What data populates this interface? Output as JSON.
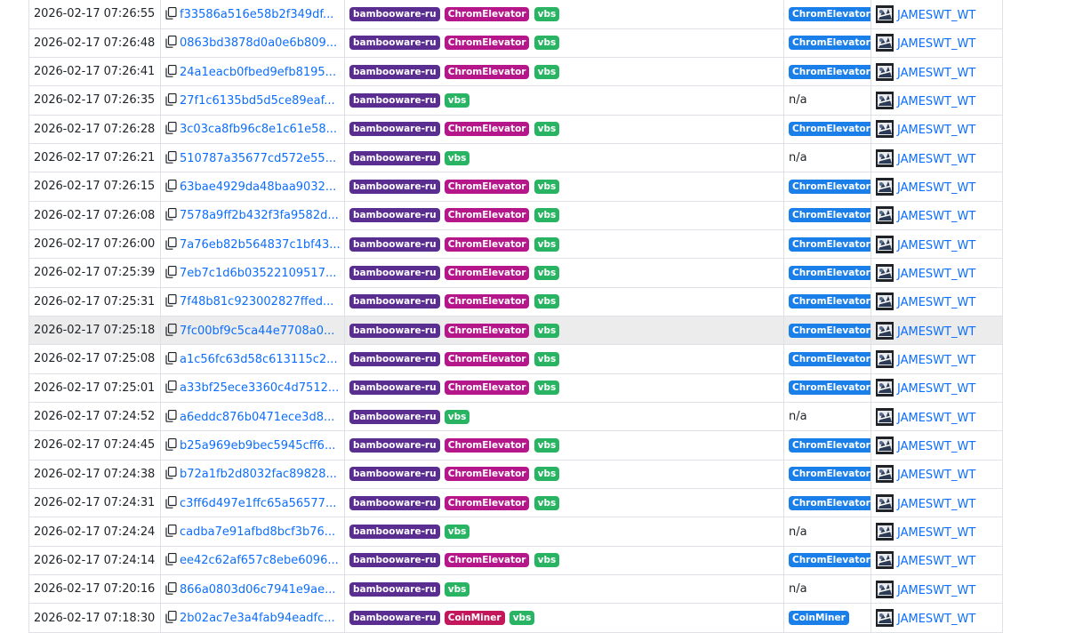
{
  "colors": {
    "link": "#0d6efd",
    "tag_bambooware": "#5a2d91",
    "tag_chromelevator": "#b5178b",
    "tag_coinminer": "#c2185b",
    "tag_vbs": "#28b463",
    "signature_badge": "#1a7fe8",
    "highlight_row": "#ececec"
  },
  "icons": {
    "copy": "copy-icon",
    "avatar": "reporter-avatar"
  },
  "rows": [
    {
      "date": "2026-02-17 07:26:55",
      "hash": "f33586a516e58b2f349df...",
      "tags": [
        "bambooware-ru",
        "ChromElevator",
        "vbs"
      ],
      "signature": "ChromElevator",
      "reporter": "JAMESWT_WT"
    },
    {
      "date": "2026-02-17 07:26:48",
      "hash": "0863bd3878d0a0e6b809...",
      "tags": [
        "bambooware-ru",
        "ChromElevator",
        "vbs"
      ],
      "signature": "ChromElevator",
      "reporter": "JAMESWT_WT"
    },
    {
      "date": "2026-02-17 07:26:41",
      "hash": "24a1eacb0fbed9efb8195...",
      "tags": [
        "bambooware-ru",
        "ChromElevator",
        "vbs"
      ],
      "signature": "ChromElevator",
      "reporter": "JAMESWT_WT"
    },
    {
      "date": "2026-02-17 07:26:35",
      "hash": "27f1c6135bd5d5ce89eaf...",
      "tags": [
        "bambooware-ru",
        "vbs"
      ],
      "signature": "n/a",
      "reporter": "JAMESWT_WT"
    },
    {
      "date": "2026-02-17 07:26:28",
      "hash": "3c03ca8fb96c8e1c61e58...",
      "tags": [
        "bambooware-ru",
        "ChromElevator",
        "vbs"
      ],
      "signature": "ChromElevator",
      "reporter": "JAMESWT_WT"
    },
    {
      "date": "2026-02-17 07:26:21",
      "hash": "510787a35677cd572e55...",
      "tags": [
        "bambooware-ru",
        "vbs"
      ],
      "signature": "n/a",
      "reporter": "JAMESWT_WT"
    },
    {
      "date": "2026-02-17 07:26:15",
      "hash": "63bae4929da48baa9032...",
      "tags": [
        "bambooware-ru",
        "ChromElevator",
        "vbs"
      ],
      "signature": "ChromElevator",
      "reporter": "JAMESWT_WT"
    },
    {
      "date": "2026-02-17 07:26:08",
      "hash": "7578a9ff2b432f3fa9582d...",
      "tags": [
        "bambooware-ru",
        "ChromElevator",
        "vbs"
      ],
      "signature": "ChromElevator",
      "reporter": "JAMESWT_WT"
    },
    {
      "date": "2026-02-17 07:26:00",
      "hash": "7a76eb82b564837c1bf43...",
      "tags": [
        "bambooware-ru",
        "ChromElevator",
        "vbs"
      ],
      "signature": "ChromElevator",
      "reporter": "JAMESWT_WT"
    },
    {
      "date": "2026-02-17 07:25:39",
      "hash": "7eb7c1d6b03522109517...",
      "tags": [
        "bambooware-ru",
        "ChromElevator",
        "vbs"
      ],
      "signature": "ChromElevator",
      "reporter": "JAMESWT_WT"
    },
    {
      "date": "2026-02-17 07:25:31",
      "hash": "7f48b81c923002827ffed...",
      "tags": [
        "bambooware-ru",
        "ChromElevator",
        "vbs"
      ],
      "signature": "ChromElevator",
      "reporter": "JAMESWT_WT"
    },
    {
      "date": "2026-02-17 07:25:18",
      "hash": "7fc00bf9c5ca44e7708a0...",
      "tags": [
        "bambooware-ru",
        "ChromElevator",
        "vbs"
      ],
      "signature": "ChromElevator",
      "reporter": "JAMESWT_WT",
      "highlighted": true
    },
    {
      "date": "2026-02-17 07:25:08",
      "hash": "a1c56fc63d58c613115c2...",
      "tags": [
        "bambooware-ru",
        "ChromElevator",
        "vbs"
      ],
      "signature": "ChromElevator",
      "reporter": "JAMESWT_WT"
    },
    {
      "date": "2026-02-17 07:25:01",
      "hash": "a33bf25ece3360c4d7512...",
      "tags": [
        "bambooware-ru",
        "ChromElevator",
        "vbs"
      ],
      "signature": "ChromElevator",
      "reporter": "JAMESWT_WT"
    },
    {
      "date": "2026-02-17 07:24:52",
      "hash": "a6eddc876b0471ece3d8...",
      "tags": [
        "bambooware-ru",
        "vbs"
      ],
      "signature": "n/a",
      "reporter": "JAMESWT_WT"
    },
    {
      "date": "2026-02-17 07:24:45",
      "hash": "b25a969eb9bec5945cff6...",
      "tags": [
        "bambooware-ru",
        "ChromElevator",
        "vbs"
      ],
      "signature": "ChromElevator",
      "reporter": "JAMESWT_WT"
    },
    {
      "date": "2026-02-17 07:24:38",
      "hash": "b72a1fb2d8032fac89828...",
      "tags": [
        "bambooware-ru",
        "ChromElevator",
        "vbs"
      ],
      "signature": "ChromElevator",
      "reporter": "JAMESWT_WT"
    },
    {
      "date": "2026-02-17 07:24:31",
      "hash": "c3ff6d497e1ffc65a56577...",
      "tags": [
        "bambooware-ru",
        "ChromElevator",
        "vbs"
      ],
      "signature": "ChromElevator",
      "reporter": "JAMESWT_WT"
    },
    {
      "date": "2026-02-17 07:24:24",
      "hash": "cadba7e91afbd8bcf3b76...",
      "tags": [
        "bambooware-ru",
        "vbs"
      ],
      "signature": "n/a",
      "reporter": "JAMESWT_WT"
    },
    {
      "date": "2026-02-17 07:24:14",
      "hash": "ee42c62af657c8ebe6096...",
      "tags": [
        "bambooware-ru",
        "ChromElevator",
        "vbs"
      ],
      "signature": "ChromElevator",
      "reporter": "JAMESWT_WT"
    },
    {
      "date": "2026-02-17 07:20:16",
      "hash": "866a0803d06c7941e9ae...",
      "tags": [
        "bambooware-ru",
        "vbs"
      ],
      "signature": "n/a",
      "reporter": "JAMESWT_WT"
    },
    {
      "date": "2026-02-17 07:18:30",
      "hash": "2b02ac7e3a4fab94eadfc...",
      "tags": [
        "bambooware-ru",
        "CoinMiner",
        "vbs"
      ],
      "signature": "CoinMiner",
      "reporter": "JAMESWT_WT"
    }
  ]
}
